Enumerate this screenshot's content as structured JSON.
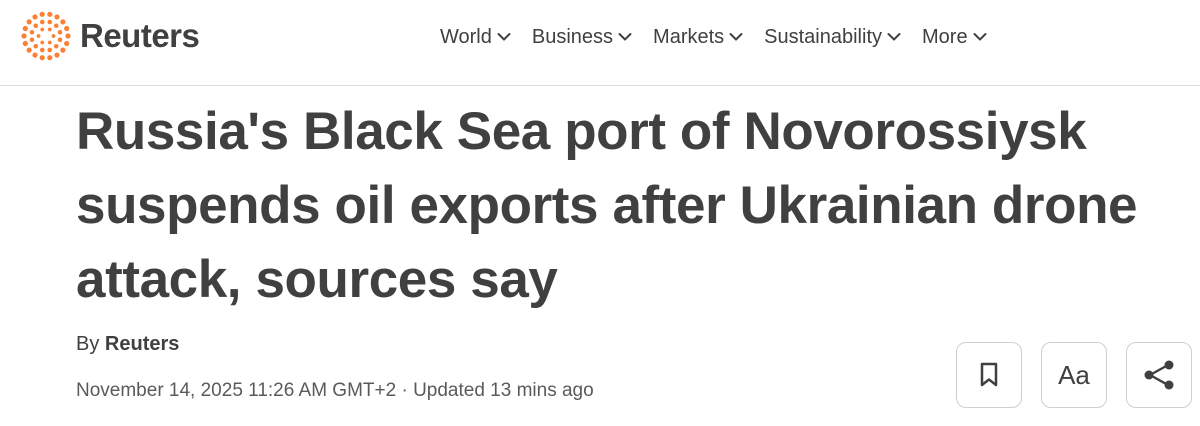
{
  "header": {
    "brand": "Reuters",
    "nav": [
      {
        "label": "World"
      },
      {
        "label": "Business"
      },
      {
        "label": "Markets"
      },
      {
        "label": "Sustainability"
      },
      {
        "label": "More"
      }
    ],
    "icons": {
      "logo": "reuters-dots-logo",
      "dropdown": "chevron-down-icon"
    },
    "colors": {
      "logo_accent": "#fb8033",
      "text": "#404040"
    }
  },
  "article": {
    "headline": "Russia's Black Sea port of Novorossiysk suspends oil exports after Ukrainian drone attack, sources say",
    "byline_prefix": "By",
    "author": "Reuters",
    "dateline": "November 14, 2025 11:26 AM GMT+2 · Updated 13 mins ago"
  },
  "actions": {
    "bookmark_icon": "bookmark-icon",
    "text_size_label": "Aa",
    "share_icon": "share-icon"
  }
}
